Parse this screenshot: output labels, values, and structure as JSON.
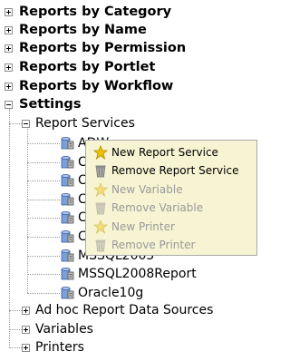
{
  "tree": {
    "top_items": [
      {
        "label": "Reports by Category",
        "state": "collapsed"
      },
      {
        "label": "Reports by Name",
        "state": "collapsed"
      },
      {
        "label": "Reports by Permission",
        "state": "collapsed"
      },
      {
        "label": "Reports by Portlet",
        "state": "collapsed"
      },
      {
        "label": "Reports by Workflow",
        "state": "collapsed"
      },
      {
        "label": "Settings",
        "state": "expanded"
      }
    ],
    "settings": {
      "report_services": {
        "label": "Report Services",
        "state": "expanded",
        "children": [
          "ADW",
          "C",
          "C",
          "C",
          "C",
          "C",
          "MSSQL2005",
          "MSSQL2008Report",
          "Oracle10g"
        ]
      },
      "others": [
        {
          "label": "Ad hoc Report Data Sources",
          "state": "collapsed"
        },
        {
          "label": "Variables",
          "state": "collapsed"
        },
        {
          "label": "Printers",
          "state": "collapsed"
        }
      ]
    }
  },
  "context_menu": {
    "items": [
      {
        "label": "New Report Service",
        "icon": "star-icon",
        "enabled": true
      },
      {
        "label": "Remove Report Service",
        "icon": "trash-icon",
        "enabled": true
      },
      {
        "label": "New Variable",
        "icon": "star-icon",
        "enabled": false
      },
      {
        "label": "Remove Variable",
        "icon": "trash-icon",
        "enabled": false
      },
      {
        "label": "New Printer",
        "icon": "star-icon",
        "enabled": false
      },
      {
        "label": "Remove Printer",
        "icon": "trash-icon",
        "enabled": false
      }
    ]
  },
  "colors": {
    "menu_background": "#f6f4d2",
    "disabled_text": "#9a9a9a",
    "tree_line": "#999999"
  }
}
